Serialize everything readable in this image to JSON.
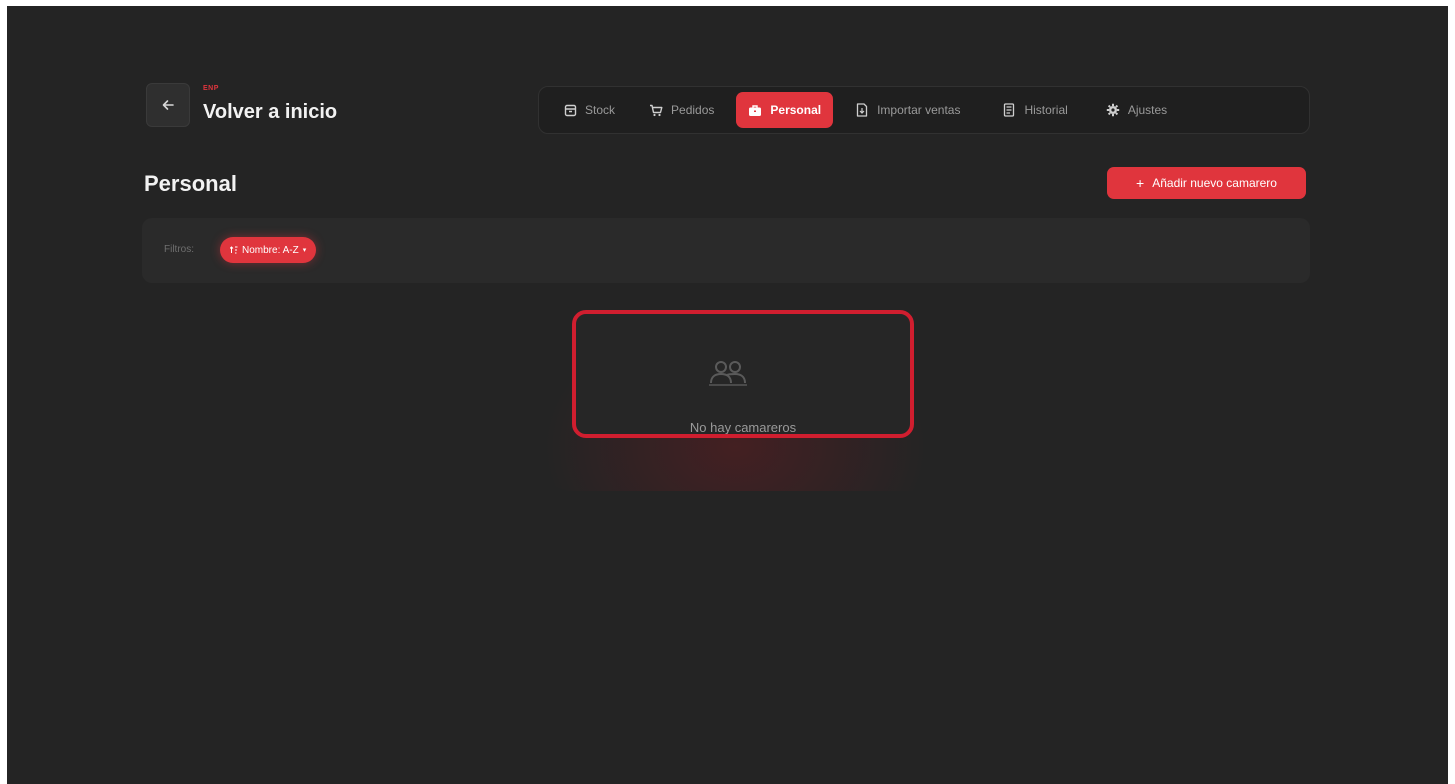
{
  "header": {
    "brand_label": "ENP",
    "back_label": "Volver a inicio"
  },
  "nav": {
    "tabs": [
      {
        "label": "Stock",
        "icon": "box-icon",
        "active": false
      },
      {
        "label": "Pedidos",
        "icon": "cart-icon",
        "active": false
      },
      {
        "label": "Personal",
        "icon": "briefcase-icon",
        "active": true
      },
      {
        "label": "Importar ventas",
        "icon": "file-import-icon",
        "active": false
      },
      {
        "label": "Historial",
        "icon": "history-icon",
        "active": false
      },
      {
        "label": "Ajustes",
        "icon": "gear-icon",
        "active": false
      }
    ]
  },
  "page": {
    "title": "Personal",
    "add_button_label": "Añadir nuevo camarero"
  },
  "filters": {
    "label": "Filtros:",
    "chip_label": "Nombre: A-Z"
  },
  "empty_state": {
    "icon": "users-icon",
    "text": "No hay camareros"
  },
  "colors": {
    "accent": "#e0353d",
    "background": "#242424",
    "highlight_border": "#d01e2f"
  }
}
